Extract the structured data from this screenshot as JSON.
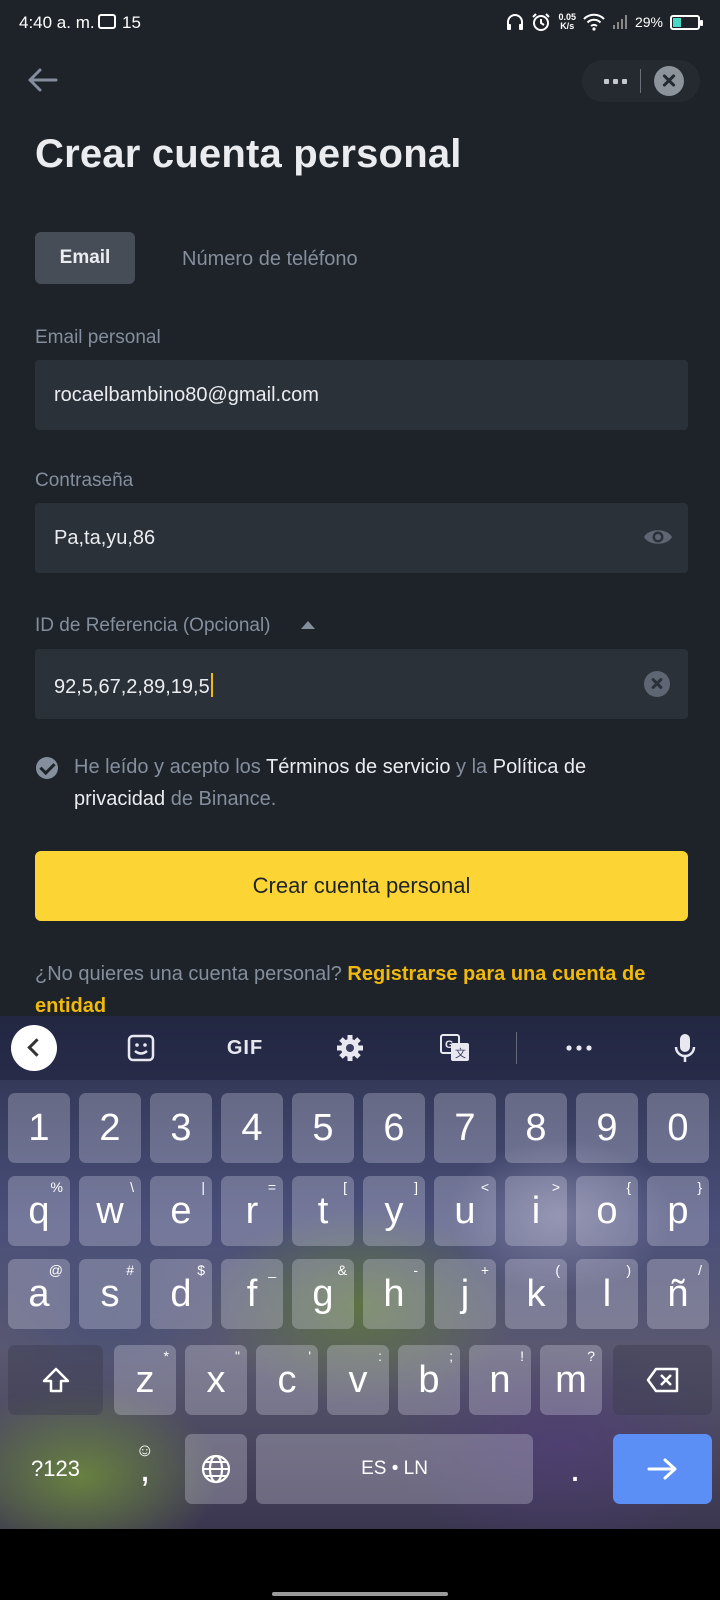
{
  "status_bar": {
    "time": "4:40 a. m.",
    "notification_count": "15",
    "net_speed_value": "0.05",
    "net_speed_unit": "K/s",
    "battery": "29%",
    "battery_level": 0.29
  },
  "page": {
    "title": "Crear cuenta personal"
  },
  "tabs": [
    {
      "label": "Email",
      "active": true
    },
    {
      "label": "Número de teléfono",
      "active": false
    }
  ],
  "email": {
    "label": "Email personal",
    "value": "rocaelbambino80@gmail.com"
  },
  "password": {
    "label": "Contraseña",
    "value": "Pa,ta,yu,86"
  },
  "referral": {
    "label": "ID de Referencia (Opcional)",
    "value": "92,5,67,2,89,19,5"
  },
  "terms": {
    "prefix": "He leído y acepto los ",
    "terms_link": "Términos de servicio",
    "middle": " y la ",
    "privacy_link": "Política de privacidad",
    "suffix": " de Binance."
  },
  "cta": {
    "label": "Crear cuenta personal"
  },
  "entity": {
    "question": "¿No quieres una cuenta personal? ",
    "link": "Registrarse para una cuenta de entidad"
  },
  "keyboard": {
    "toolbar_gif": "GIF",
    "number_row": [
      "1",
      "2",
      "3",
      "4",
      "5",
      "6",
      "7",
      "8",
      "9",
      "0"
    ],
    "row1": [
      {
        "key": "q",
        "alt": "%"
      },
      {
        "key": "w",
        "alt": "\\"
      },
      {
        "key": "e",
        "alt": "|"
      },
      {
        "key": "r",
        "alt": "="
      },
      {
        "key": "t",
        "alt": "["
      },
      {
        "key": "y",
        "alt": "]"
      },
      {
        "key": "u",
        "alt": "<"
      },
      {
        "key": "i",
        "alt": ">"
      },
      {
        "key": "o",
        "alt": "{"
      },
      {
        "key": "p",
        "alt": "}"
      }
    ],
    "row2": [
      {
        "key": "a",
        "alt": "@"
      },
      {
        "key": "s",
        "alt": "#"
      },
      {
        "key": "d",
        "alt": "$"
      },
      {
        "key": "f",
        "alt": "_"
      },
      {
        "key": "g",
        "alt": "&"
      },
      {
        "key": "h",
        "alt": "-"
      },
      {
        "key": "j",
        "alt": "+"
      },
      {
        "key": "k",
        "alt": "("
      },
      {
        "key": "l",
        "alt": ")"
      },
      {
        "key": "ñ",
        "alt": "/"
      }
    ],
    "row3": [
      {
        "key": "z",
        "alt": "*"
      },
      {
        "key": "x",
        "alt": "\""
      },
      {
        "key": "c",
        "alt": "'"
      },
      {
        "key": "v",
        "alt": ":"
      },
      {
        "key": "b",
        "alt": ";"
      },
      {
        "key": "n",
        "alt": "!"
      },
      {
        "key": "m",
        "alt": "?"
      }
    ],
    "symbols_key": "?123",
    "comma_key": ",",
    "space_label": "ES • LN",
    "period_key": ".",
    "enter_icon": "arrow-right-icon"
  },
  "colors": {
    "background": "#1e2329",
    "field": "#2b3139",
    "accent_yellow": "#fcd535",
    "link_yellow": "#f0b90b",
    "muted_text": "#848e9c"
  }
}
